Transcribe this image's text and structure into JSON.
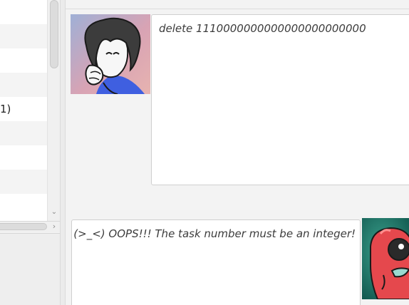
{
  "task_list": {
    "visible_row_text": "1)"
  },
  "conversation": {
    "messages": [
      {
        "sender": "user",
        "avatar_icon": "user-avatar-drawing",
        "text": "delete 1110000000000000000000000"
      },
      {
        "sender": "bot",
        "avatar_icon": "bot-avatar-red-creature",
        "text": "(>_<) OOPS!!! The task number must be an integer!"
      }
    ]
  },
  "colors": {
    "background": "#f3f3f3",
    "bubble": "#ffffff",
    "bubble_border": "#cfcfcf",
    "message_text": "#3c3c3c",
    "bot_avatar_bg": "#0e6b5f",
    "bot_creature": "#e5484d"
  }
}
